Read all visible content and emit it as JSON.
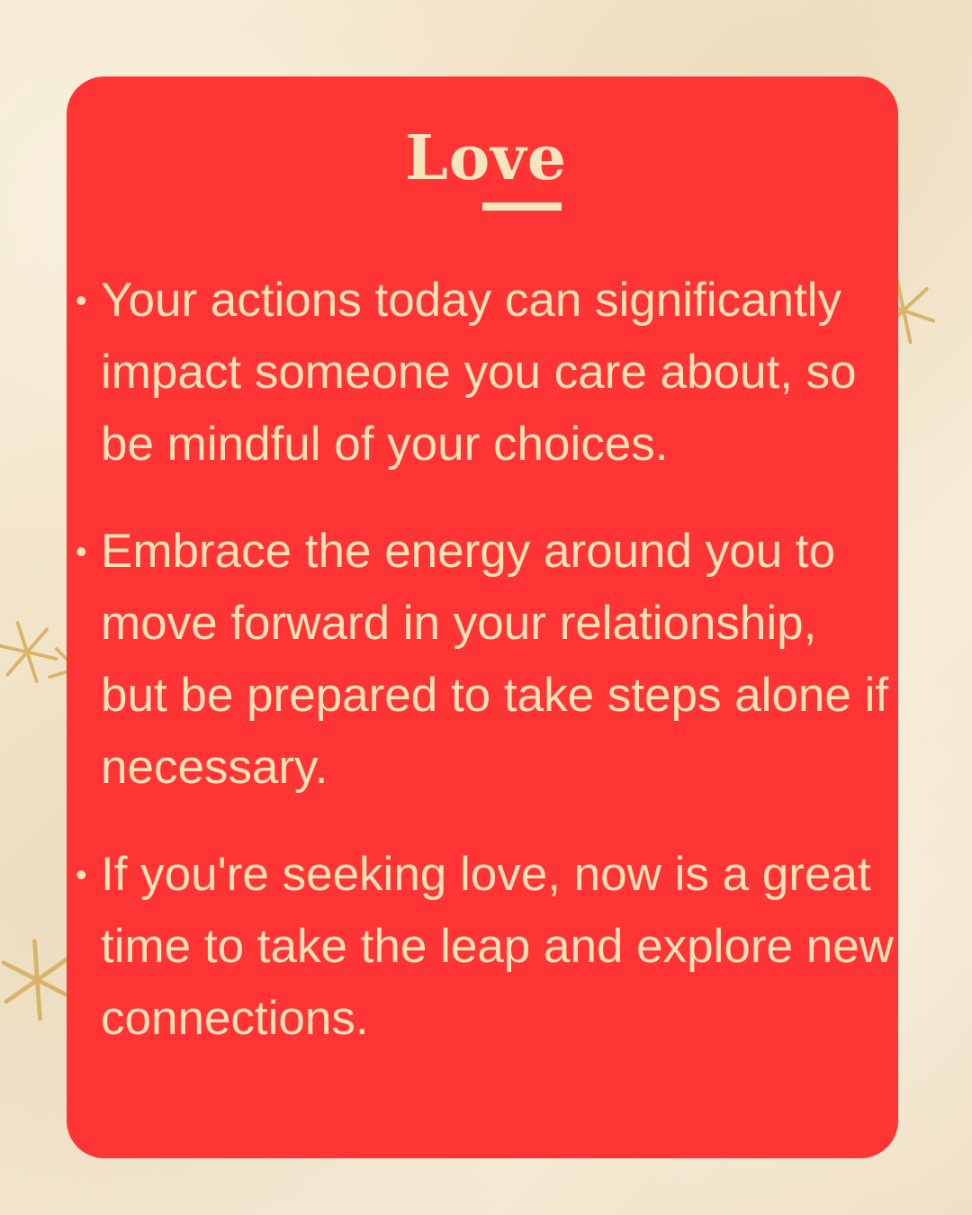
{
  "title": "Love",
  "bullet_symbol": "•",
  "items": [
    {
      "text": "Your actions today can significantly impact someone you care about, so be mindful of your choices."
    },
    {
      "text": "Embrace the energy around you to move forward in your relationship, but be prepared to take steps alone if necessary."
    },
    {
      "text": "If you're seeking love, now is a great time to take the leap and explore new connections."
    }
  ],
  "colors": {
    "background": "#f3e7cf",
    "card": "#ff3434",
    "text": "#f9e1b8",
    "sparkle": "#d8b46a"
  },
  "decorations": {
    "sparkles": "gold sparkle icons"
  }
}
